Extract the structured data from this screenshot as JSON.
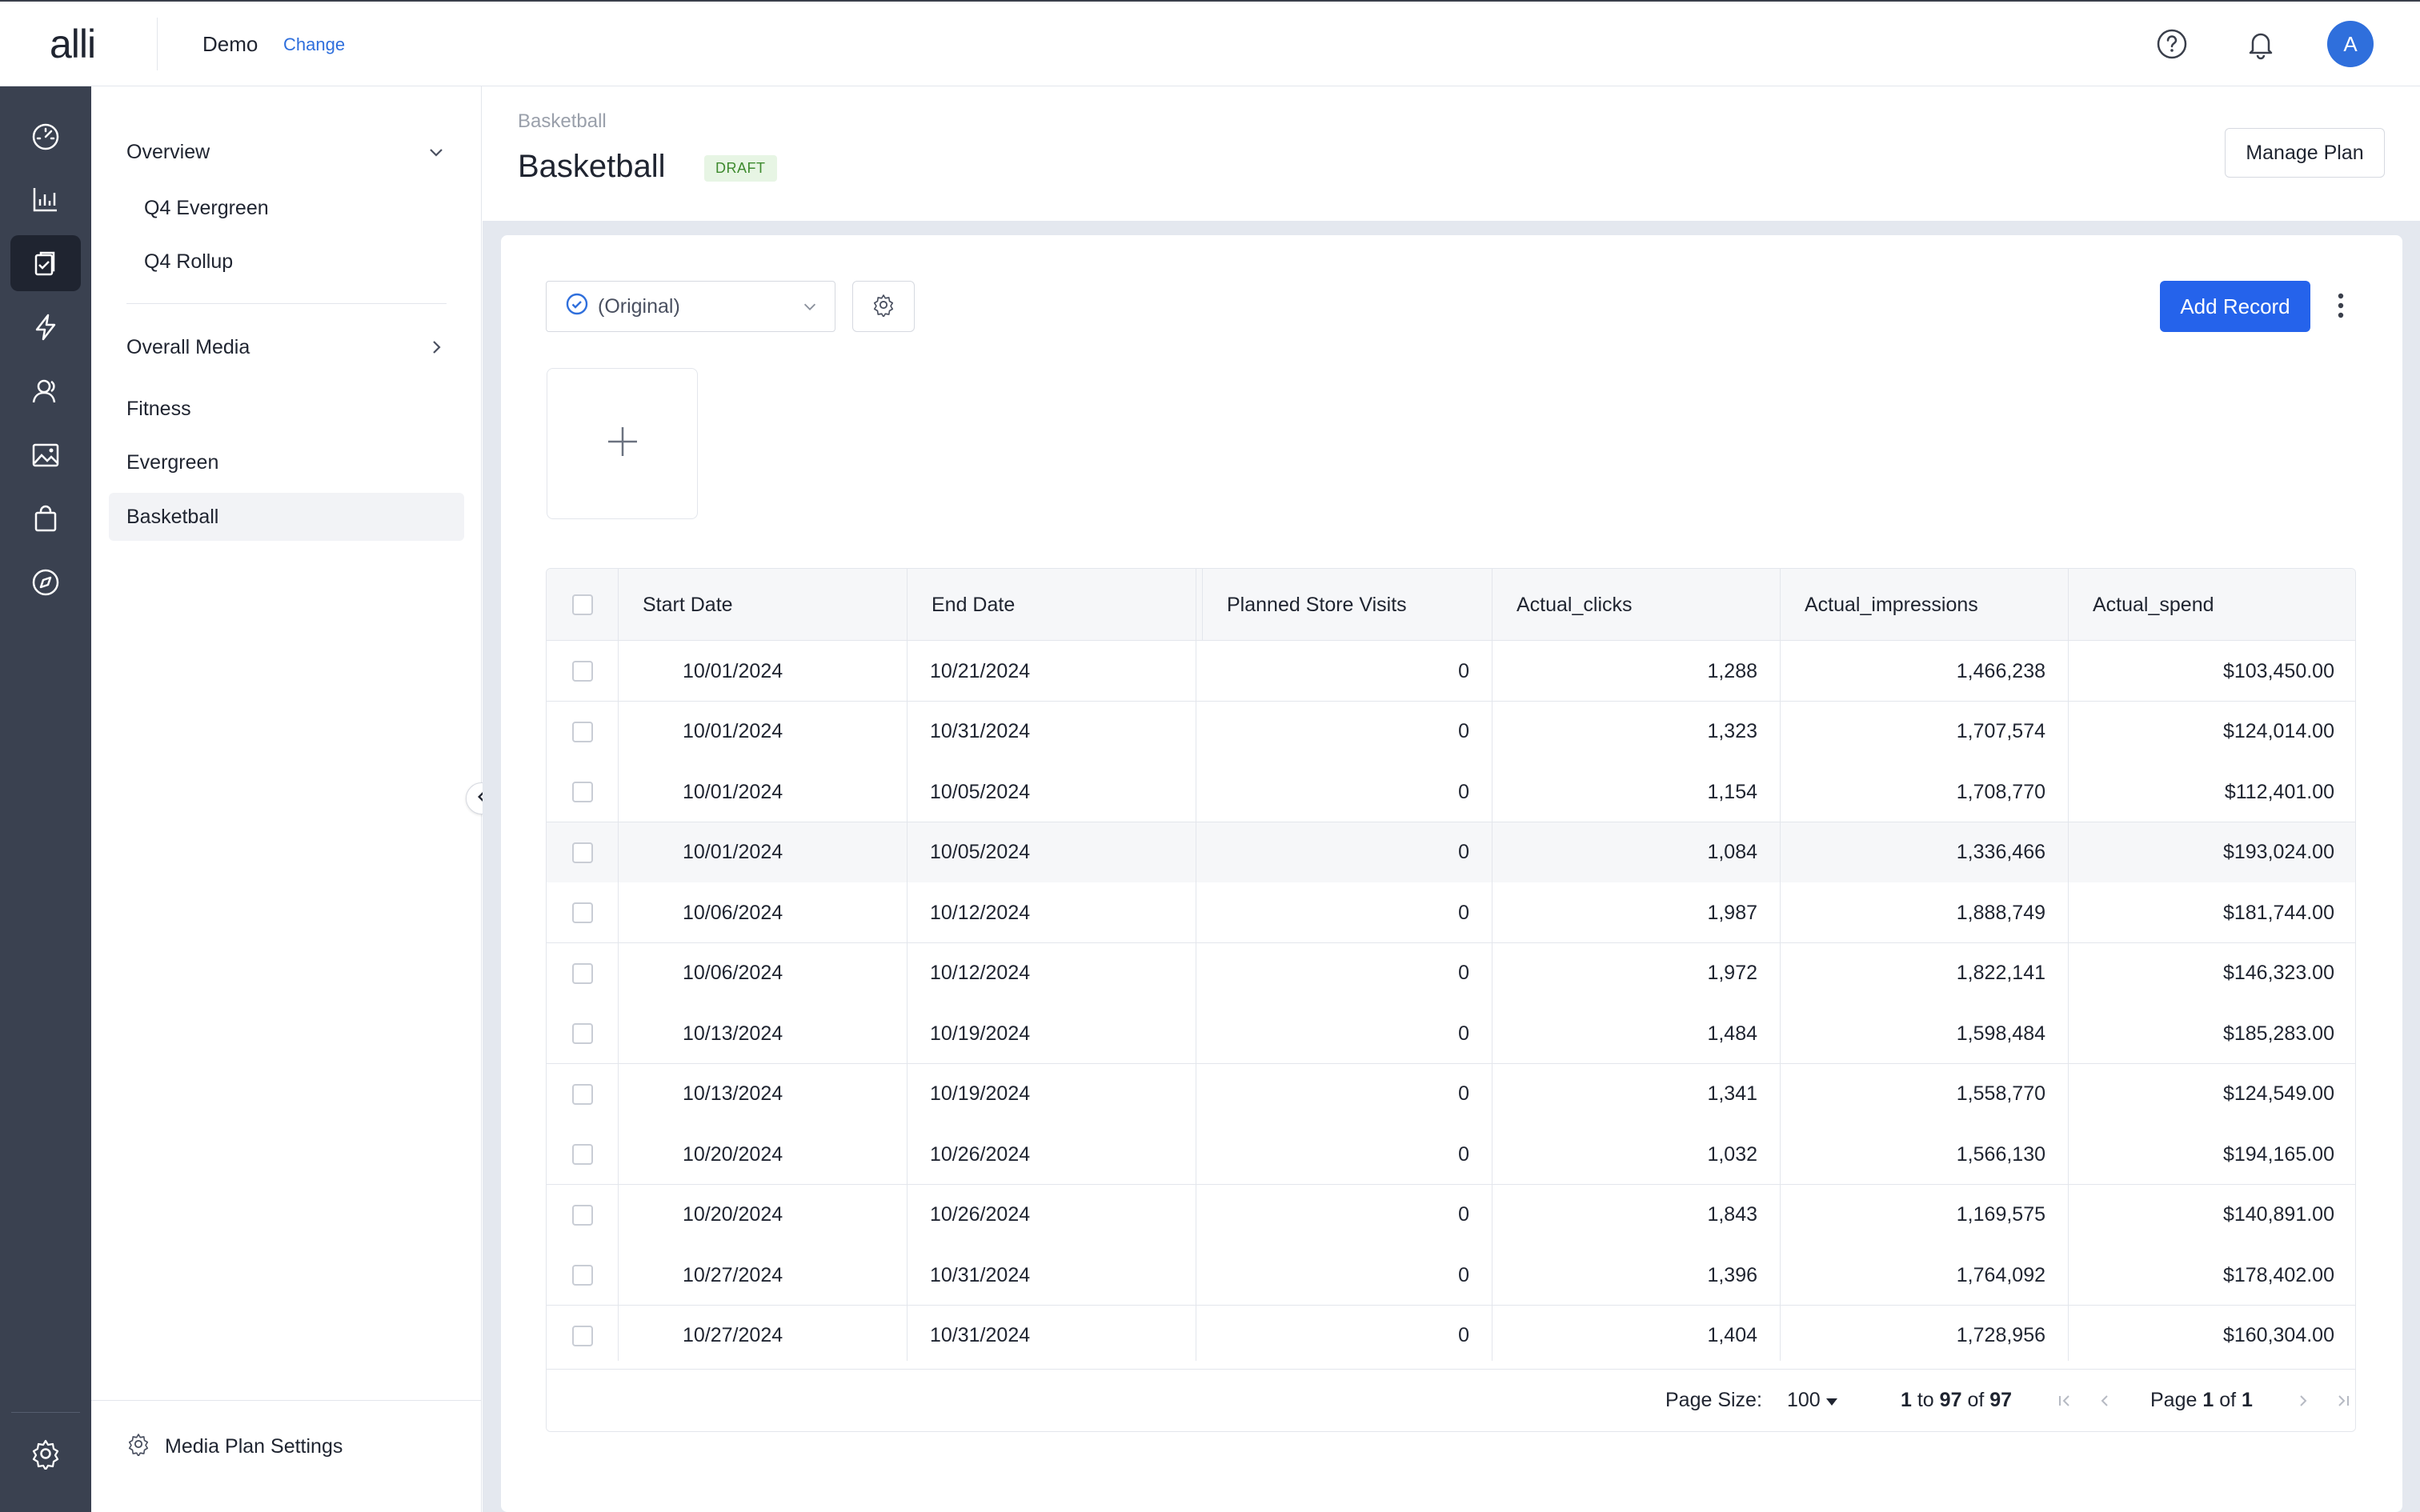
{
  "topbar": {
    "logo": "alli",
    "org_name": "Demo",
    "change_label": "Change",
    "avatar_initial": "A"
  },
  "rail": {
    "icons": [
      "dashboard-icon",
      "bar-chart-icon",
      "clipboard-icon",
      "lightning-icon",
      "audience-icon",
      "image-icon",
      "shopping-bag-icon",
      "compass-icon"
    ],
    "active_index": 2,
    "bottom_icon": "settings-icon"
  },
  "sidenav": {
    "overview": "Overview",
    "overview_children": [
      "Q4 Evergreen",
      "Q4 Rollup"
    ],
    "overall_media": "Overall Media",
    "items": [
      "Fitness",
      "Evergreen",
      "Basketball"
    ],
    "active_item": "Basketball",
    "settings_label": "Media Plan Settings"
  },
  "header": {
    "breadcrumb": "Basketball",
    "title": "Basketball",
    "badge": "DRAFT",
    "manage_plan": "Manage Plan"
  },
  "toolbar": {
    "view_value": "(Original)",
    "add_record": "Add Record"
  },
  "table": {
    "columns": [
      "Start Date",
      "End Date",
      "Planned Store Visits",
      "Actual_clicks",
      "Actual_impressions",
      "Actual_spend"
    ],
    "rows": [
      [
        "10/01/2024",
        "10/21/2024",
        "0",
        "1,288",
        "1,466,238",
        "$103,450.00"
      ],
      [
        "10/01/2024",
        "10/31/2024",
        "0",
        "1,323",
        "1,707,574",
        "$124,014.00"
      ],
      [
        "10/01/2024",
        "10/05/2024",
        "0",
        "1,154",
        "1,708,770",
        "$112,401.00"
      ],
      [
        "10/01/2024",
        "10/05/2024",
        "0",
        "1,084",
        "1,336,466",
        "$193,024.00"
      ],
      [
        "10/06/2024",
        "10/12/2024",
        "0",
        "1,987",
        "1,888,749",
        "$181,744.00"
      ],
      [
        "10/06/2024",
        "10/12/2024",
        "0",
        "1,972",
        "1,822,141",
        "$146,323.00"
      ],
      [
        "10/13/2024",
        "10/19/2024",
        "0",
        "1,484",
        "1,598,484",
        "$185,283.00"
      ],
      [
        "10/13/2024",
        "10/19/2024",
        "0",
        "1,341",
        "1,558,770",
        "$124,549.00"
      ],
      [
        "10/20/2024",
        "10/26/2024",
        "0",
        "1,032",
        "1,566,130",
        "$194,165.00"
      ],
      [
        "10/20/2024",
        "10/26/2024",
        "0",
        "1,843",
        "1,169,575",
        "$140,891.00"
      ],
      [
        "10/27/2024",
        "10/31/2024",
        "0",
        "1,396",
        "1,764,092",
        "$178,402.00"
      ],
      [
        "10/27/2024",
        "10/31/2024",
        "0",
        "1,404",
        "1,728,956",
        "$160,304.00"
      ]
    ],
    "hover_row": 3
  },
  "pagination": {
    "page_size_label": "Page Size:",
    "page_size": "100",
    "range_from": "1",
    "range_to_word": "to",
    "range_to": "97",
    "of_word": "of",
    "total": "97",
    "page_word": "Page",
    "current_page": "1",
    "page_of_word": "of",
    "total_pages": "1"
  },
  "colors": {
    "accent": "#2563eb",
    "rail": "#3a4150",
    "badge_bg": "#e7f5e4",
    "badge_text": "#3e8a2e"
  }
}
